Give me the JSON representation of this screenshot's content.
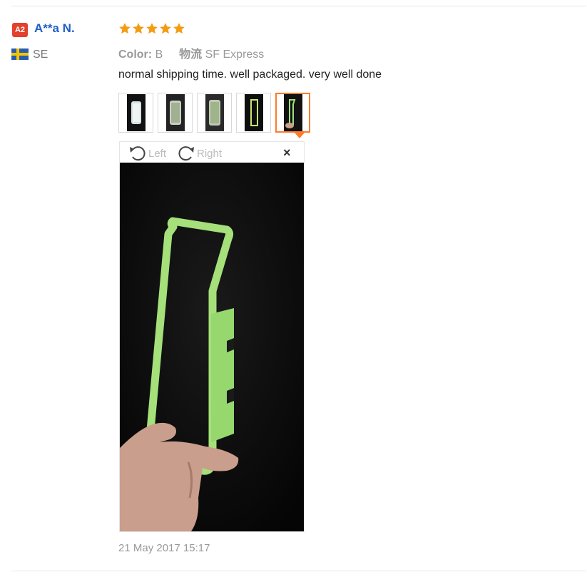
{
  "reviewer": {
    "badge": "A2",
    "name": "A**a N.",
    "country": "SE",
    "flag_icon": "sweden-flag-icon"
  },
  "review": {
    "rating": 5,
    "rating_color": "#f39c12",
    "color_label": "Color:",
    "color_value": "B",
    "logistics_label": "物流",
    "logistics_value": "SF Express",
    "text": "normal shipping time. well packaged. very well done",
    "date": "21 May 2017 15:17"
  },
  "viewer": {
    "rotate_left_label": "Left",
    "rotate_right_label": "Right",
    "close_label": "×",
    "active_thumb_index": 4
  },
  "accent_color": "#ff7a2a"
}
